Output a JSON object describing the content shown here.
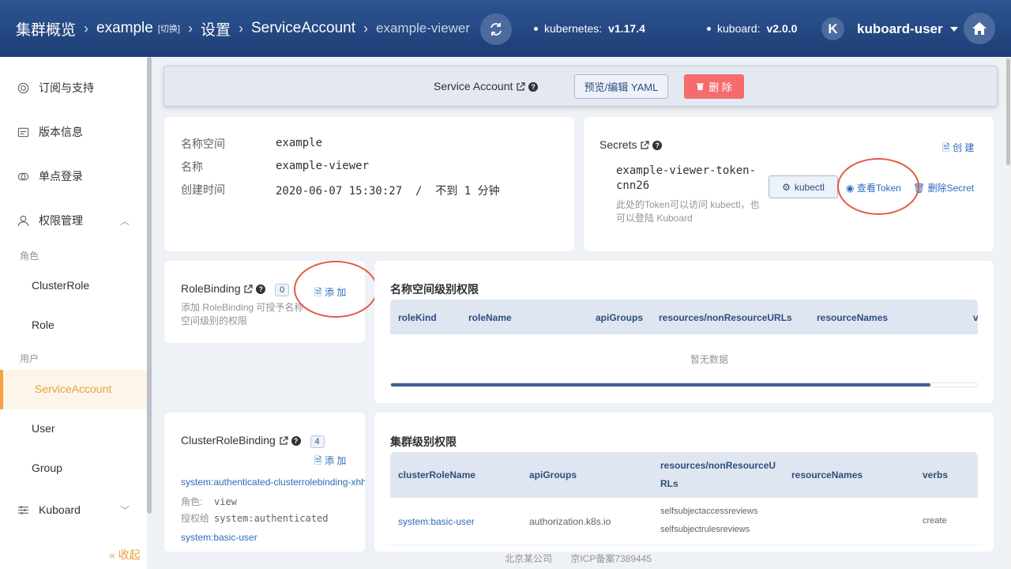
{
  "header": {
    "breadcrumbs": {
      "cluster": "集群概览",
      "namespace": "example",
      "switch": "[切换]",
      "settings": "设置",
      "service_account": "ServiceAccount",
      "current": "example-viewer"
    },
    "kubernetes_label": "kubernetes:",
    "kubernetes_version": "v1.17.4",
    "kuboard_label": "kuboard:",
    "kuboard_version": "v2.0.0",
    "avatar_letter": "K",
    "username": "kuboard-user"
  },
  "sidebar": {
    "items": [
      {
        "label": "订阅与支持",
        "icon": "subscribe-icon"
      },
      {
        "label": "版本信息",
        "icon": "version-icon"
      },
      {
        "label": "单点登录",
        "icon": "sso-icon"
      },
      {
        "label": "权限管理",
        "icon": "user-icon"
      }
    ],
    "group_role": "角色",
    "role_items": [
      "ClusterRole",
      "Role"
    ],
    "group_user": "用户",
    "user_items": [
      "ServiceAccount",
      "User",
      "Group"
    ],
    "kuboard": "Kuboard",
    "collapse": "收起"
  },
  "top_card": {
    "title": "Service Account",
    "yaml_button": "预览/编辑 YAML",
    "delete_button": "删 除",
    "delete_color": "#f56c6c"
  },
  "info": {
    "namespace_label": "名称空间",
    "namespace_value": "example",
    "name_label": "名称",
    "name_value": "example-viewer",
    "created_label": "创建时间",
    "created_value": "2020-06-07 15:30:27  /  不到 1 分钟"
  },
  "secrets": {
    "title": "Secrets",
    "create": "创 建",
    "token_name_line1": "example-viewer-token-",
    "token_name_line2": "cnn26",
    "hint_line1": "此处的Token可以访问 kubectl，也",
    "hint_line2": "可以登陆 Kuboard",
    "kubectl_button": "kubectl",
    "view_token": "查看Token",
    "delete_secret": "删除Secret"
  },
  "rolebinding": {
    "title": "RoleBinding",
    "count": "0",
    "add": "添 加",
    "hint_line1": "添加 RoleBinding 可授予名称",
    "hint_line2": "空间级别的权限"
  },
  "namespace_perms": {
    "title": "名称空间级别权限",
    "columns": [
      "roleKind",
      "roleName",
      "apiGroups",
      "resources/nonResourceURLs",
      "resourceNames",
      "v"
    ],
    "empty": "暂无数据"
  },
  "clusterrolebinding": {
    "title": "ClusterRoleBinding",
    "count": "4",
    "add": "添 加",
    "binding_name": "system:authenticated-clusterrolebinding-xhh",
    "role_label": "角色:",
    "role_value": "view",
    "grant_label": "授权给",
    "grant_value": "system:authenticated",
    "next_binding": "system:basic-user"
  },
  "cluster_perms": {
    "title": "集群级别权限",
    "columns": [
      "clusterRoleName",
      "apiGroups",
      "resources/nonResourceU",
      "RLs",
      "resourceNames",
      "verbs"
    ],
    "row": {
      "name": "system:basic-user",
      "apiGroups": "authorization.k8s.io",
      "resource1": "selfsubjectaccessreviews",
      "resource2": "selfsubjectrulesreviews",
      "verbs": "create"
    }
  },
  "footer": {
    "company": "北京某公司",
    "icp": "京ICP备案7389445"
  }
}
